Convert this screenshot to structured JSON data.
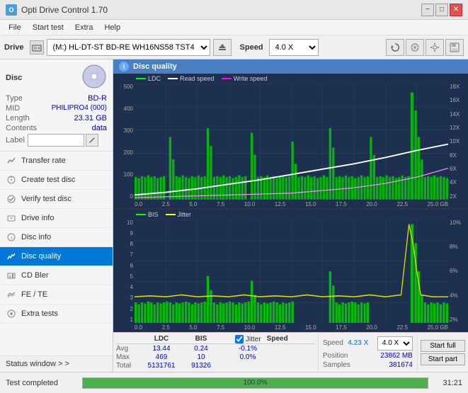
{
  "app": {
    "title": "Opti Drive Control 1.70",
    "title_icon": "O"
  },
  "title_controls": {
    "minimize": "−",
    "maximize": "□",
    "close": "✕"
  },
  "menu": {
    "items": [
      "File",
      "Start test",
      "Extra",
      "Help"
    ]
  },
  "drive_toolbar": {
    "drive_label": "Drive",
    "drive_value": "(M:)  HL-DT-ST BD-RE  WH16NS58 TST4",
    "speed_label": "Speed",
    "speed_value": "4.0 X"
  },
  "disc_panel": {
    "title": "Disc",
    "type_label": "Type",
    "type_value": "BD-R",
    "mid_label": "MID",
    "mid_value": "PHILIPRO4 (000)",
    "length_label": "Length",
    "length_value": "23.31 GB",
    "contents_label": "Contents",
    "contents_value": "data",
    "label_label": "Label",
    "label_value": ""
  },
  "nav_items": [
    {
      "label": "Transfer rate",
      "icon": "chart-icon",
      "active": false
    },
    {
      "label": "Create test disc",
      "icon": "disc-icon",
      "active": false
    },
    {
      "label": "Verify test disc",
      "icon": "verify-icon",
      "active": false
    },
    {
      "label": "Drive info",
      "icon": "info-icon",
      "active": false
    },
    {
      "label": "Disc info",
      "icon": "disc-info-icon",
      "active": false
    },
    {
      "label": "Disc quality",
      "icon": "quality-icon",
      "active": true
    },
    {
      "label": "CD Bler",
      "icon": "bler-icon",
      "active": false
    },
    {
      "label": "FE / TE",
      "icon": "fete-icon",
      "active": false
    },
    {
      "label": "Extra tests",
      "icon": "extra-icon",
      "active": false
    }
  ],
  "status_window_btn": "Status window > >",
  "chart_header": {
    "icon": "i",
    "title": "Disc quality"
  },
  "chart1": {
    "legend": [
      {
        "label": "LDC",
        "color": "#00ff00"
      },
      {
        "label": "Read speed",
        "color": "#ffffff"
      },
      {
        "label": "Write speed",
        "color": "#ff00ff"
      }
    ],
    "y_axis_left": [
      "500",
      "400",
      "300",
      "200",
      "100",
      "0"
    ],
    "y_axis_right": [
      "18X",
      "16X",
      "14X",
      "12X",
      "10X",
      "8X",
      "6X",
      "4X",
      "2X"
    ],
    "x_axis": [
      "0.0",
      "2.5",
      "5.0",
      "7.5",
      "10.0",
      "12.5",
      "15.0",
      "17.5",
      "20.0",
      "22.5",
      "25.0 GB"
    ]
  },
  "chart2": {
    "legend": [
      {
        "label": "BIS",
        "color": "#00ff00"
      },
      {
        "label": "Jitter",
        "color": "#ffff00"
      }
    ],
    "y_axis_left": [
      "10",
      "9",
      "8",
      "7",
      "6",
      "5",
      "4",
      "3",
      "2",
      "1"
    ],
    "y_axis_right": [
      "10%",
      "8%",
      "6%",
      "4%",
      "2%"
    ],
    "x_axis": [
      "0.0",
      "2.5",
      "5.0",
      "7.5",
      "10.0",
      "12.5",
      "15.0",
      "17.5",
      "20.0",
      "22.5",
      "25.0 GB"
    ]
  },
  "stats": {
    "headers": [
      "",
      "LDC",
      "BIS",
      "",
      "Jitter",
      "Speed",
      ""
    ],
    "avg_label": "Avg",
    "avg_ldc": "13.44",
    "avg_bis": "0.24",
    "avg_jitter": "-0.1%",
    "max_label": "Max",
    "max_ldc": "469",
    "max_bis": "10",
    "max_jitter": "0.0%",
    "total_label": "Total",
    "total_ldc": "5131761",
    "total_bis": "91326",
    "jitter_checked": true,
    "speed_label": "Speed",
    "speed_value": "4.23 X",
    "speed_select": "4.0 X",
    "position_label": "Position",
    "position_value": "23862 MB",
    "samples_label": "Samples",
    "samples_value": "381674",
    "btn_start_full": "Start full",
    "btn_start_part": "Start part"
  },
  "status_bar": {
    "text": "Test completed",
    "progress": 100,
    "time": "31:21"
  }
}
